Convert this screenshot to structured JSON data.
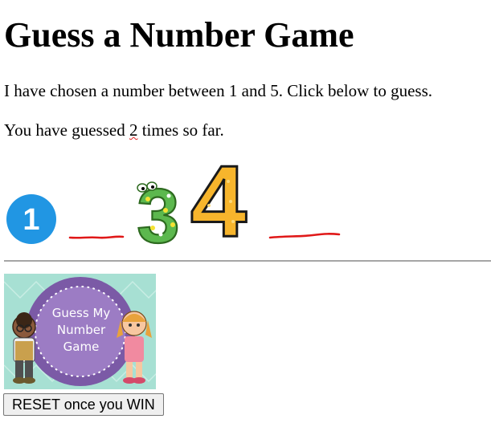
{
  "page": {
    "title": "Guess a Number Game",
    "intro": "I have chosen a number between 1 and 5. Click below to guess.",
    "guess_prefix": "You have guessed ",
    "guess_count": "2",
    "guess_suffix": " times so far."
  },
  "choices": {
    "one": "1",
    "three": "3",
    "four": "4"
  },
  "banner": {
    "line1": "Guess My",
    "line2": "Number",
    "line3": "Game"
  },
  "reset": {
    "label": "RESET once you WIN"
  }
}
